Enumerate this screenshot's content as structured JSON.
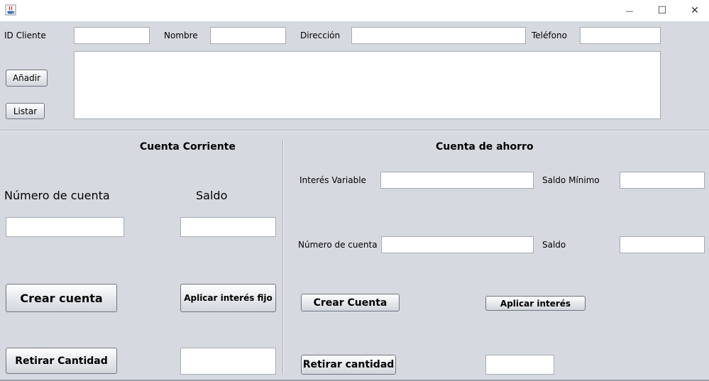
{
  "window": {
    "minimize_glyph": "—",
    "maximize_glyph": "☐",
    "close_glyph": "✕"
  },
  "client": {
    "id_label": "ID Cliente",
    "name_label": "Nombre",
    "address_label": "Dirección",
    "phone_label": "Teléfono",
    "id_value": "",
    "name_value": "",
    "address_value": "",
    "phone_value": "",
    "list_text": "",
    "add_button": "Añadir",
    "list_button": "Listar"
  },
  "current_account": {
    "title": "Cuenta Corriente",
    "number_label": "Número de cuenta",
    "balance_label": "Saldo",
    "number_value": "",
    "balance_value": "",
    "create_button": "Crear cuenta",
    "fixed_interest_button": "Aplicar interés fijo",
    "withdraw_button": "Retirar Cantidad",
    "withdraw_value": ""
  },
  "savings_account": {
    "title": "Cuenta de ahorro",
    "variable_interest_label": "Interés Variable",
    "min_balance_label": "Saldo Mínimo",
    "number_label": "Número de cuenta",
    "balance_label": "Saldo",
    "variable_interest_value": "",
    "min_balance_value": "",
    "number_value": "",
    "balance_value": "",
    "create_button": "Crear Cuenta",
    "interest_button": "Aplicar interés",
    "withdraw_button": "Retirar cantidad",
    "withdraw_value": ""
  },
  "colors": {
    "background": "#d6d9df",
    "titlebar": "#ffffff"
  },
  "icons": {
    "app": "java-app-icon"
  }
}
